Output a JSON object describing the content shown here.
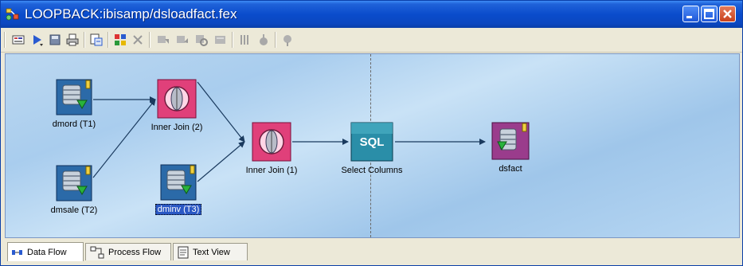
{
  "window": {
    "title": "LOOPBACK:ibisamp/dsloadfact.fex"
  },
  "colors": {
    "titlebar": "#0a4ccc",
    "canvas": "#a9cdee",
    "join_node": "#e0407a",
    "sql_node": "#2a8ea8",
    "source_node": "#2b6aa8",
    "target_node": "#9a3c8c"
  },
  "toolbar": {
    "icons": [
      "properties-icon",
      "run-icon",
      "save-icon",
      "print-icon",
      "sql-report-icon",
      "add-component-icon",
      "delete-icon",
      "move-left-icon",
      "move-right-icon",
      "zoom-icon",
      "target-icon",
      "columns-icon",
      "stats-icon",
      "settings-icon"
    ]
  },
  "canvas": {
    "nodes": [
      {
        "id": "dmord",
        "label": "dmord (T1)",
        "kind": "source"
      },
      {
        "id": "dmsale",
        "label": "dmsale (T2)",
        "kind": "source"
      },
      {
        "id": "join2",
        "label": "Inner Join (2)",
        "kind": "join"
      },
      {
        "id": "dminv",
        "label": "dminv (T3)",
        "kind": "source",
        "selected": true
      },
      {
        "id": "join1",
        "label": "Inner Join (1)",
        "kind": "join"
      },
      {
        "id": "select",
        "label": "Select Columns",
        "kind": "sql",
        "badge": "SQL"
      },
      {
        "id": "dsfact",
        "label": "dsfact",
        "kind": "target"
      }
    ]
  },
  "tabs": [
    {
      "label": "Data Flow",
      "active": true
    },
    {
      "label": "Process Flow",
      "active": false
    },
    {
      "label": "Text View",
      "active": false
    }
  ]
}
